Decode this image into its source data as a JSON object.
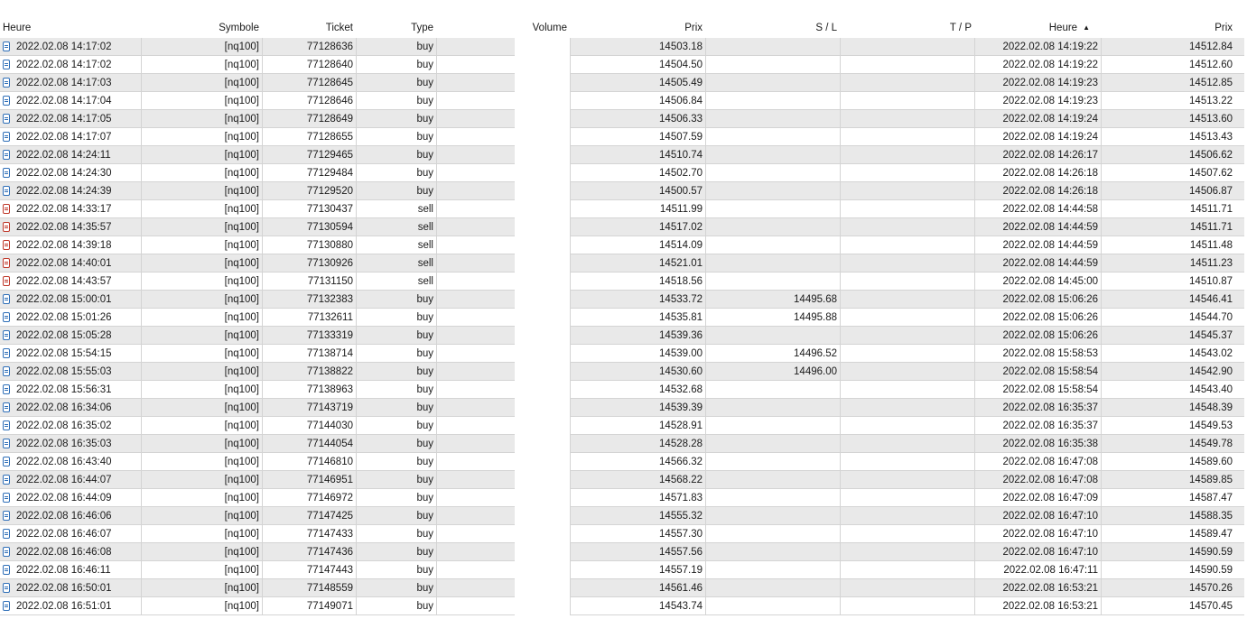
{
  "columns": {
    "time": "Heure",
    "symbol": "Symbole",
    "ticket": "Ticket",
    "type": "Type",
    "volume": "Volume",
    "price": "Prix",
    "sl": "S / L",
    "tp": "T / P",
    "close_time": "Heure",
    "close_price": "Prix",
    "sort_indicator": "▲"
  },
  "rows": [
    {
      "time": "2022.02.08 14:17:02",
      "symbol": "[nq100]",
      "ticket": "77128636",
      "type": "buy",
      "volume": "",
      "price": "14503.18",
      "sl": "",
      "tp": "",
      "close_time": "2022.02.08 14:19:22",
      "close_price": "14512.84"
    },
    {
      "time": "2022.02.08 14:17:02",
      "symbol": "[nq100]",
      "ticket": "77128640",
      "type": "buy",
      "volume": "",
      "price": "14504.50",
      "sl": "",
      "tp": "",
      "close_time": "2022.02.08 14:19:22",
      "close_price": "14512.60"
    },
    {
      "time": "2022.02.08 14:17:03",
      "symbol": "[nq100]",
      "ticket": "77128645",
      "type": "buy",
      "volume": "",
      "price": "14505.49",
      "sl": "",
      "tp": "",
      "close_time": "2022.02.08 14:19:23",
      "close_price": "14512.85"
    },
    {
      "time": "2022.02.08 14:17:04",
      "symbol": "[nq100]",
      "ticket": "77128646",
      "type": "buy",
      "volume": "",
      "price": "14506.84",
      "sl": "",
      "tp": "",
      "close_time": "2022.02.08 14:19:23",
      "close_price": "14513.22"
    },
    {
      "time": "2022.02.08 14:17:05",
      "symbol": "[nq100]",
      "ticket": "77128649",
      "type": "buy",
      "volume": "",
      "price": "14506.33",
      "sl": "",
      "tp": "",
      "close_time": "2022.02.08 14:19:24",
      "close_price": "14513.60"
    },
    {
      "time": "2022.02.08 14:17:07",
      "symbol": "[nq100]",
      "ticket": "77128655",
      "type": "buy",
      "volume": "",
      "price": "14507.59",
      "sl": "",
      "tp": "",
      "close_time": "2022.02.08 14:19:24",
      "close_price": "14513.43"
    },
    {
      "time": "2022.02.08 14:24:11",
      "symbol": "[nq100]",
      "ticket": "77129465",
      "type": "buy",
      "volume": "",
      "price": "14510.74",
      "sl": "",
      "tp": "",
      "close_time": "2022.02.08 14:26:17",
      "close_price": "14506.62"
    },
    {
      "time": "2022.02.08 14:24:30",
      "symbol": "[nq100]",
      "ticket": "77129484",
      "type": "buy",
      "volume": "",
      "price": "14502.70",
      "sl": "",
      "tp": "",
      "close_time": "2022.02.08 14:26:18",
      "close_price": "14507.62"
    },
    {
      "time": "2022.02.08 14:24:39",
      "symbol": "[nq100]",
      "ticket": "77129520",
      "type": "buy",
      "volume": "",
      "price": "14500.57",
      "sl": "",
      "tp": "",
      "close_time": "2022.02.08 14:26:18",
      "close_price": "14506.87"
    },
    {
      "time": "2022.02.08 14:33:17",
      "symbol": "[nq100]",
      "ticket": "77130437",
      "type": "sell",
      "volume": "",
      "price": "14511.99",
      "sl": "",
      "tp": "",
      "close_time": "2022.02.08 14:44:58",
      "close_price": "14511.71"
    },
    {
      "time": "2022.02.08 14:35:57",
      "symbol": "[nq100]",
      "ticket": "77130594",
      "type": "sell",
      "volume": "",
      "price": "14517.02",
      "sl": "",
      "tp": "",
      "close_time": "2022.02.08 14:44:59",
      "close_price": "14511.71"
    },
    {
      "time": "2022.02.08 14:39:18",
      "symbol": "[nq100]",
      "ticket": "77130880",
      "type": "sell",
      "volume": "",
      "price": "14514.09",
      "sl": "",
      "tp": "",
      "close_time": "2022.02.08 14:44:59",
      "close_price": "14511.48"
    },
    {
      "time": "2022.02.08 14:40:01",
      "symbol": "[nq100]",
      "ticket": "77130926",
      "type": "sell",
      "volume": "",
      "price": "14521.01",
      "sl": "",
      "tp": "",
      "close_time": "2022.02.08 14:44:59",
      "close_price": "14511.23"
    },
    {
      "time": "2022.02.08 14:43:57",
      "symbol": "[nq100]",
      "ticket": "77131150",
      "type": "sell",
      "volume": "",
      "price": "14518.56",
      "sl": "",
      "tp": "",
      "close_time": "2022.02.08 14:45:00",
      "close_price": "14510.87"
    },
    {
      "time": "2022.02.08 15:00:01",
      "symbol": "[nq100]",
      "ticket": "77132383",
      "type": "buy",
      "volume": "",
      "price": "14533.72",
      "sl": "14495.68",
      "tp": "",
      "close_time": "2022.02.08 15:06:26",
      "close_price": "14546.41"
    },
    {
      "time": "2022.02.08 15:01:26",
      "symbol": "[nq100]",
      "ticket": "77132611",
      "type": "buy",
      "volume": "",
      "price": "14535.81",
      "sl": "14495.88",
      "tp": "",
      "close_time": "2022.02.08 15:06:26",
      "close_price": "14544.70"
    },
    {
      "time": "2022.02.08 15:05:28",
      "symbol": "[nq100]",
      "ticket": "77133319",
      "type": "buy",
      "volume": "",
      "price": "14539.36",
      "sl": "",
      "tp": "",
      "close_time": "2022.02.08 15:06:26",
      "close_price": "14545.37"
    },
    {
      "time": "2022.02.08 15:54:15",
      "symbol": "[nq100]",
      "ticket": "77138714",
      "type": "buy",
      "volume": "",
      "price": "14539.00",
      "sl": "14496.52",
      "tp": "",
      "close_time": "2022.02.08 15:58:53",
      "close_price": "14543.02"
    },
    {
      "time": "2022.02.08 15:55:03",
      "symbol": "[nq100]",
      "ticket": "77138822",
      "type": "buy",
      "volume": "",
      "price": "14530.60",
      "sl": "14496.00",
      "tp": "",
      "close_time": "2022.02.08 15:58:54",
      "close_price": "14542.90"
    },
    {
      "time": "2022.02.08 15:56:31",
      "symbol": "[nq100]",
      "ticket": "77138963",
      "type": "buy",
      "volume": "",
      "price": "14532.68",
      "sl": "",
      "tp": "",
      "close_time": "2022.02.08 15:58:54",
      "close_price": "14543.40"
    },
    {
      "time": "2022.02.08 16:34:06",
      "symbol": "[nq100]",
      "ticket": "77143719",
      "type": "buy",
      "volume": "",
      "price": "14539.39",
      "sl": "",
      "tp": "",
      "close_time": "2022.02.08 16:35:37",
      "close_price": "14548.39"
    },
    {
      "time": "2022.02.08 16:35:02",
      "symbol": "[nq100]",
      "ticket": "77144030",
      "type": "buy",
      "volume": "",
      "price": "14528.91",
      "sl": "",
      "tp": "",
      "close_time": "2022.02.08 16:35:37",
      "close_price": "14549.53"
    },
    {
      "time": "2022.02.08 16:35:03",
      "symbol": "[nq100]",
      "ticket": "77144054",
      "type": "buy",
      "volume": "",
      "price": "14528.28",
      "sl": "",
      "tp": "",
      "close_time": "2022.02.08 16:35:38",
      "close_price": "14549.78"
    },
    {
      "time": "2022.02.08 16:43:40",
      "symbol": "[nq100]",
      "ticket": "77146810",
      "type": "buy",
      "volume": "",
      "price": "14566.32",
      "sl": "",
      "tp": "",
      "close_time": "2022.02.08 16:47:08",
      "close_price": "14589.60"
    },
    {
      "time": "2022.02.08 16:44:07",
      "symbol": "[nq100]",
      "ticket": "77146951",
      "type": "buy",
      "volume": "",
      "price": "14568.22",
      "sl": "",
      "tp": "",
      "close_time": "2022.02.08 16:47:08",
      "close_price": "14589.85"
    },
    {
      "time": "2022.02.08 16:44:09",
      "symbol": "[nq100]",
      "ticket": "77146972",
      "type": "buy",
      "volume": "",
      "price": "14571.83",
      "sl": "",
      "tp": "",
      "close_time": "2022.02.08 16:47:09",
      "close_price": "14587.47"
    },
    {
      "time": "2022.02.08 16:46:06",
      "symbol": "[nq100]",
      "ticket": "77147425",
      "type": "buy",
      "volume": "",
      "price": "14555.32",
      "sl": "",
      "tp": "",
      "close_time": "2022.02.08 16:47:10",
      "close_price": "14588.35"
    },
    {
      "time": "2022.02.08 16:46:07",
      "symbol": "[nq100]",
      "ticket": "77147433",
      "type": "buy",
      "volume": "",
      "price": "14557.30",
      "sl": "",
      "tp": "",
      "close_time": "2022.02.08 16:47:10",
      "close_price": "14589.47"
    },
    {
      "time": "2022.02.08 16:46:08",
      "symbol": "[nq100]",
      "ticket": "77147436",
      "type": "buy",
      "volume": "",
      "price": "14557.56",
      "sl": "",
      "tp": "",
      "close_time": "2022.02.08 16:47:10",
      "close_price": "14590.59"
    },
    {
      "time": "2022.02.08 16:46:11",
      "symbol": "[nq100]",
      "ticket": "77147443",
      "type": "buy",
      "volume": "",
      "price": "14557.19",
      "sl": "",
      "tp": "",
      "close_time": "2022.02.08 16:47:11",
      "close_price": "14590.59"
    },
    {
      "time": "2022.02.08 16:50:01",
      "symbol": "[nq100]",
      "ticket": "77148559",
      "type": "buy",
      "volume": "",
      "price": "14561.46",
      "sl": "",
      "tp": "",
      "close_time": "2022.02.08 16:53:21",
      "close_price": "14570.26"
    },
    {
      "time": "2022.02.08 16:51:01",
      "symbol": "[nq100]",
      "ticket": "77149071",
      "type": "buy",
      "volume": "",
      "price": "14543.74",
      "sl": "",
      "tp": "",
      "close_time": "2022.02.08 16:53:21",
      "close_price": "14570.45"
    }
  ],
  "icons": {
    "buy": "buy-position-icon",
    "sell": "sell-position-icon"
  },
  "colors": {
    "row_band": "#e9e9e9",
    "buy_icon": "#2f6fb8",
    "sell_icon": "#c0392b",
    "grid_line": "#d4d4d4"
  }
}
